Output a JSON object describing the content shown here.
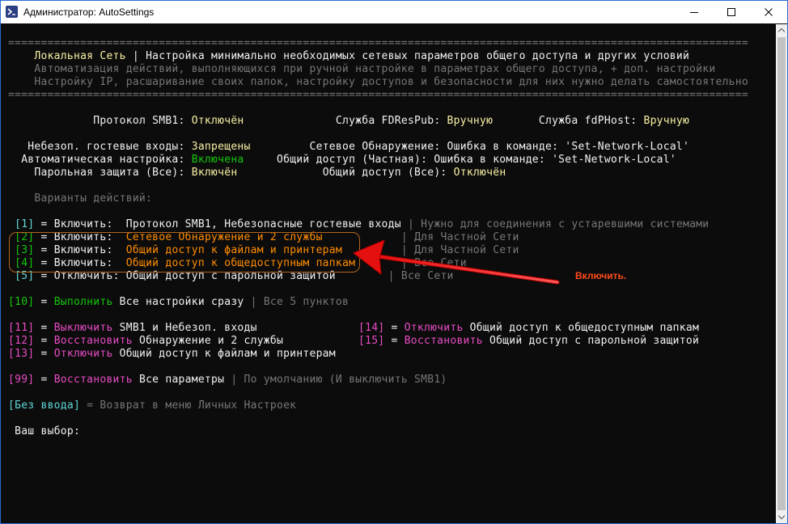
{
  "window": {
    "title": "Администратор: AutoSettings",
    "icon": "powershell-icon",
    "minimize_icon": "minimize-icon",
    "maximize_icon": "maximize-icon",
    "close_icon": "close-icon",
    "border_color": "#2a6bd1"
  },
  "console": {
    "separator": "=================================================================================================================",
    "header": {
      "title": "Локальная Сеть",
      "bar": "|",
      "desc": "Настройка минимально необходимых сетевых параметров общего доступа и других условий",
      "line2": "Автоматизация действий, выполняющихся при ручной настройке в параметрах общего доступа, + доп. настройки",
      "line3": "Настройку IP, расшаривание своих папок, настройку доступов и безопасности для них нужно делать самостоятельно"
    },
    "status": {
      "smb1_label": "Протокол SMB1:",
      "smb1_value": "Отключён",
      "fdrespub_label": "Служба FDResPub:",
      "fdrespub_value": "Вручную",
      "fdphost_label": "Служба fdPHost:",
      "fdphost_value": "Вручную",
      "guest_label": "Небезоп. гостевые входы:",
      "guest_value": "Запрещены",
      "discovery_label": "Сетевое Обнаружение:",
      "discovery_value": "Ошибка в команде: 'Set-Network-Local'",
      "auto_label": "Автоматическая настройка:",
      "auto_value": "Включена",
      "share_private_label": "Общий доступ (Частная):",
      "share_private_value": "Ошибка в команде: 'Set-Network-Local'",
      "pwd_label": "Парольная защита (Все):",
      "pwd_value": "Включён",
      "share_all_label": "Общий доступ (Все):",
      "share_all_value": "Отключён"
    },
    "actions_title": "Варианты действий:",
    "items": [
      {
        "num": "[1]",
        "verb": "Включить:",
        "text": "Протокол SMB1, Небезопасные гостевые входы",
        "note": "Нужно для соединения с устаревшими системами"
      },
      {
        "num": "[2]",
        "verb": "Включить:",
        "text": "Сетевое Обнаружение и 2 службы",
        "note": "Для Частной Сети"
      },
      {
        "num": "[3]",
        "verb": "Включить:",
        "text": "Общий доступ к файлам и принтерам",
        "note": "Для Частной Сети"
      },
      {
        "num": "[4]",
        "verb": "Включить:",
        "text": "Общий доступ к общедоступным папкам",
        "note": "Все Сети"
      },
      {
        "num": "[5]",
        "verb": "Отключить:",
        "text": "Общий доступ с парольной защитой",
        "note": "Все Сети"
      },
      {
        "num": "[10]",
        "verb": "Выполнить",
        "text": "Все настройки сразу",
        "note": "Все 5 пунктов"
      },
      {
        "num": "[11]",
        "verb": "Выключить",
        "text": "SMB1 и Небезоп. входы"
      },
      {
        "num": "[14]",
        "verb": "Отключить",
        "text": "Общий доступ к общедоступным папкам"
      },
      {
        "num": "[12]",
        "verb": "Восстановить",
        "text": "Обнаружение и 2 службы"
      },
      {
        "num": "[15]",
        "verb": "Восстановить",
        "text": "Общий доступ с парольной защитой"
      },
      {
        "num": "[13]",
        "verb": "Отключить",
        "text": "Общий доступ к файлам и принтерам"
      },
      {
        "num": "[99]",
        "verb": "Восстановить",
        "text": "Все параметры",
        "note": "По умолчанию (И выключить SMB1)"
      }
    ],
    "no_input_key": "[Без ввода]",
    "no_input_text": "= Возврат в меню Личных Настроек",
    "prompt": "Ваш выбор:"
  },
  "annotation": {
    "label": "Включить.",
    "color": "#ff4a1a",
    "arrow_icon": "red-arrow-icon"
  },
  "scrollbar": {
    "up_icon": "scroll-up-icon",
    "down_icon": "scroll-down-icon"
  },
  "colors": {
    "background": "#0c0c0c",
    "yellow": "#f9f1a5",
    "green": "#16c60c",
    "cyan": "#61d6d6",
    "magenta": "#b4009e",
    "orange": "#ff8c00",
    "gray": "#767676"
  }
}
